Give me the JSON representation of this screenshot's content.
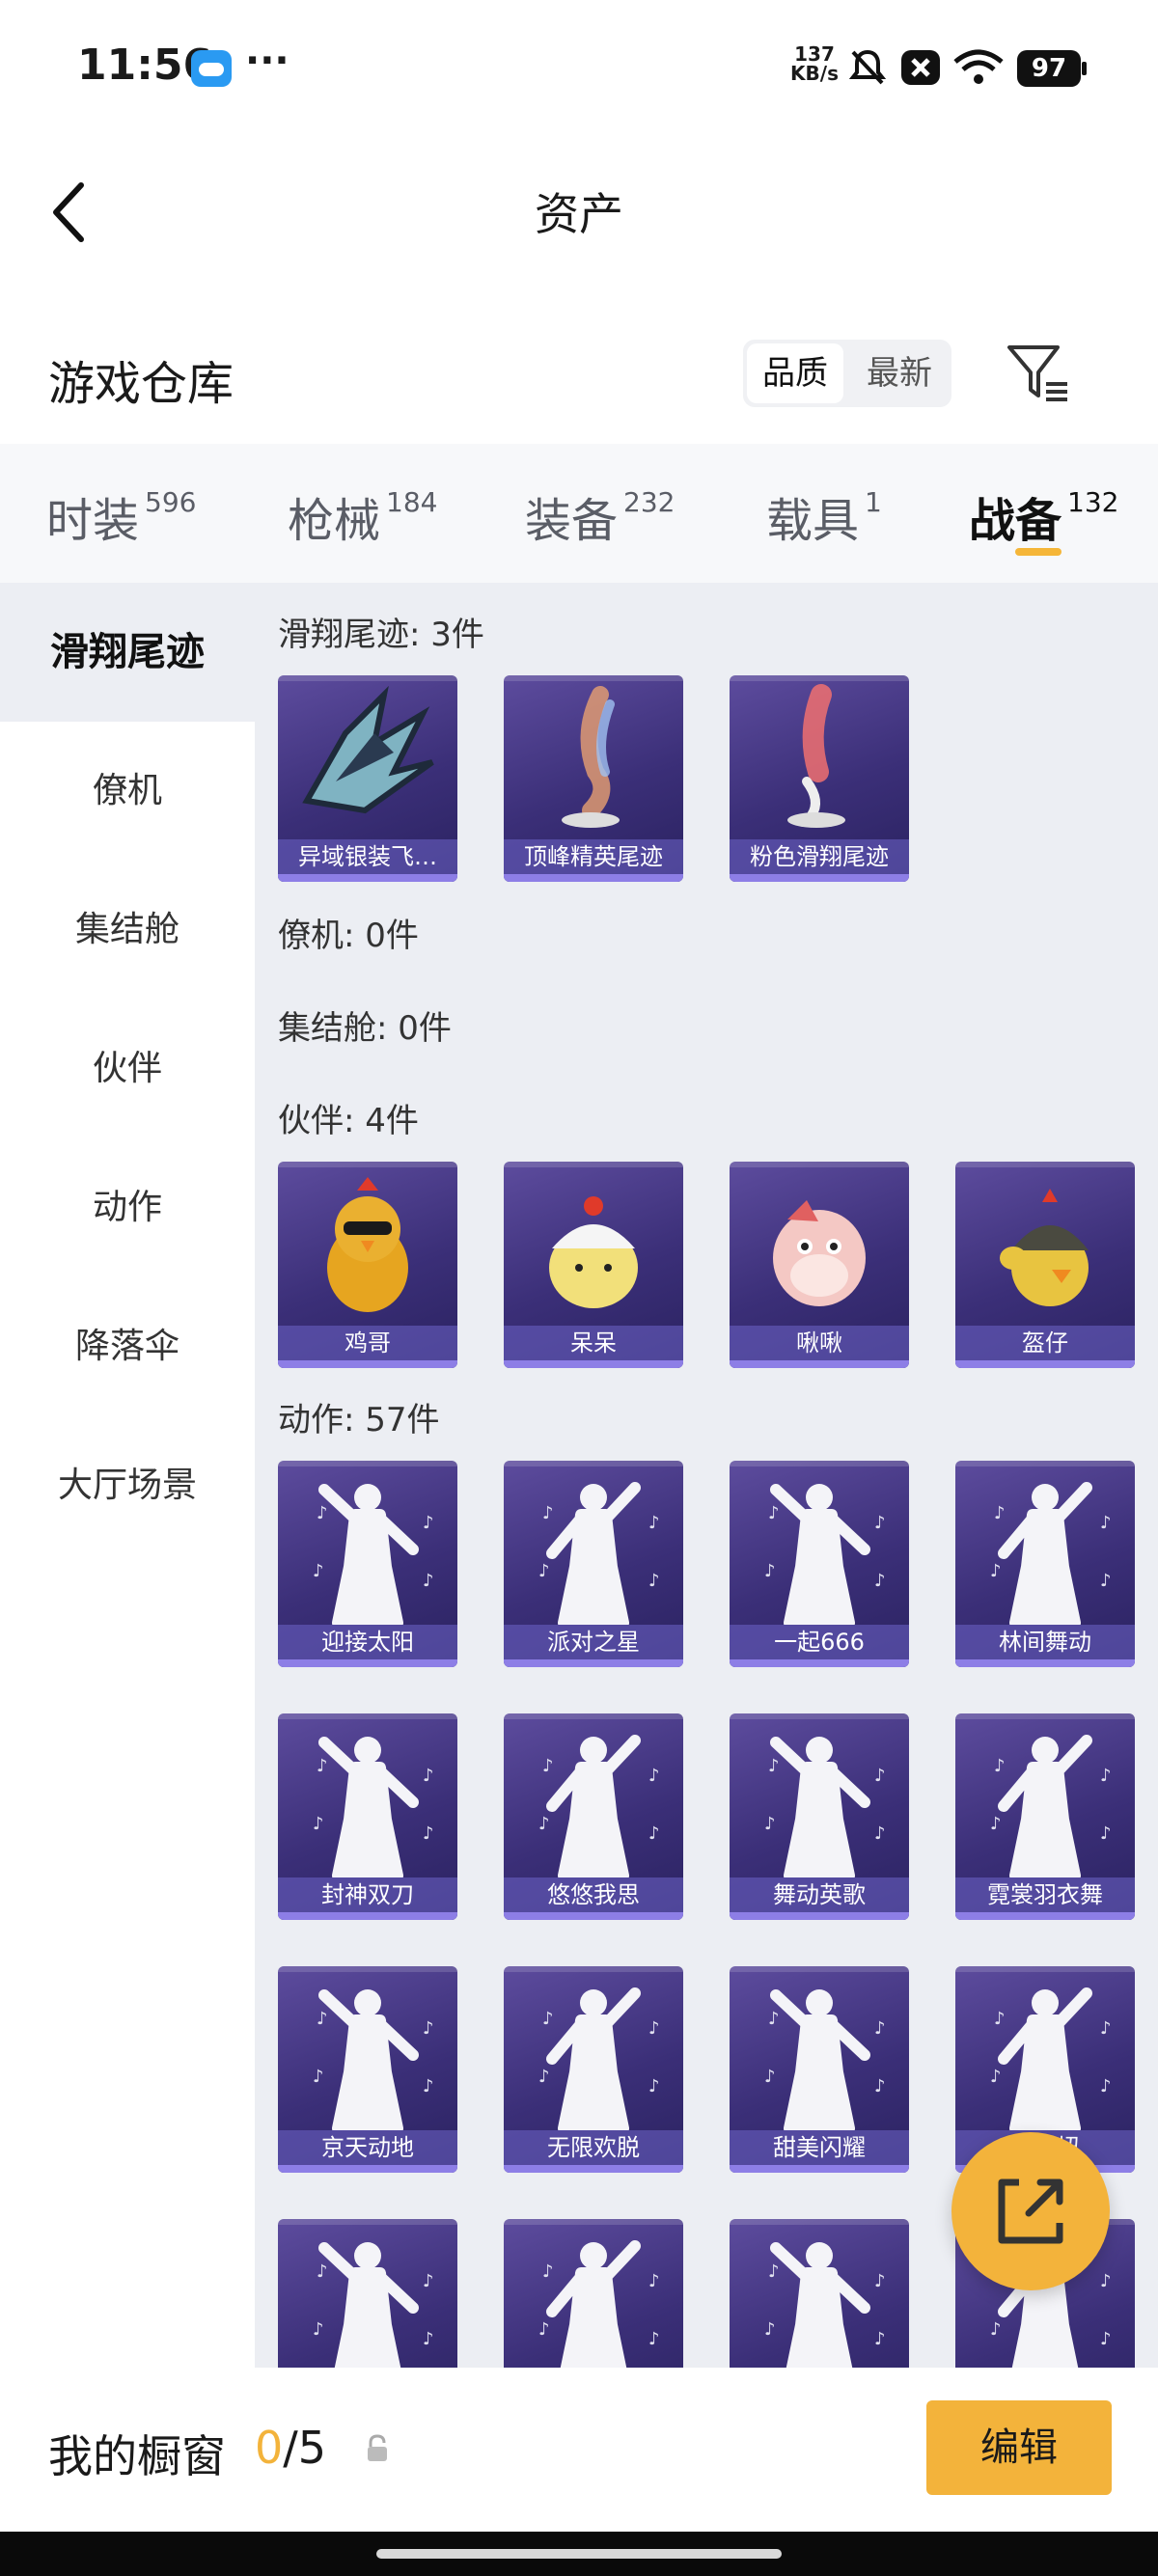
{
  "status_bar": {
    "time": "11:56",
    "more": "···",
    "speed_top": "137",
    "speed_bottom": "KB/s",
    "battery": "97"
  },
  "header": {
    "title": "资产"
  },
  "warehouse": {
    "title": "游戏仓库",
    "sort_options": [
      "品质",
      "最新"
    ],
    "active_sort": "品质"
  },
  "tabs": [
    {
      "label": "时装",
      "count": "596"
    },
    {
      "label": "枪械",
      "count": "184"
    },
    {
      "label": "装备",
      "count": "232"
    },
    {
      "label": "载具",
      "count": "1"
    },
    {
      "label": "战备",
      "count": "132"
    }
  ],
  "active_tab": "战备",
  "sidebar": [
    "滑翔尾迹",
    "僚机",
    "集结舱",
    "伙伴",
    "动作",
    "降落伞",
    "大厅场景"
  ],
  "active_sidebar": "滑翔尾迹",
  "sections": {
    "glide": {
      "heading": "滑翔尾迹: 3件",
      "items": [
        "异域银装飞…",
        "顶峰精英尾迹",
        "粉色滑翔尾迹"
      ]
    },
    "wingman": {
      "heading": "僚机: 0件"
    },
    "pod": {
      "heading": "集结舱: 0件"
    },
    "partner": {
      "heading": "伙伴: 4件",
      "items": [
        "鸡哥",
        "呆呆",
        "啾啾",
        "盔仔"
      ]
    },
    "emote": {
      "heading": "动作: 57件",
      "items": [
        "迎接太阳",
        "派对之星",
        "一起666",
        "林间舞动",
        "封神双刀",
        "悠悠我思",
        "舞动英歌",
        "霓裳羽衣舞",
        "京天动地",
        "无限欢脱",
        "甜美闪耀",
        "扭扭扭",
        "",
        "",
        "",
        ""
      ]
    }
  },
  "bottom": {
    "showcase_label": "我的橱窗",
    "current": "0",
    "total": "/5",
    "edit": "编辑"
  },
  "colors": {
    "accent": "#f3b33b",
    "card": "#3b2f78",
    "content_bg": "#eceef3"
  }
}
